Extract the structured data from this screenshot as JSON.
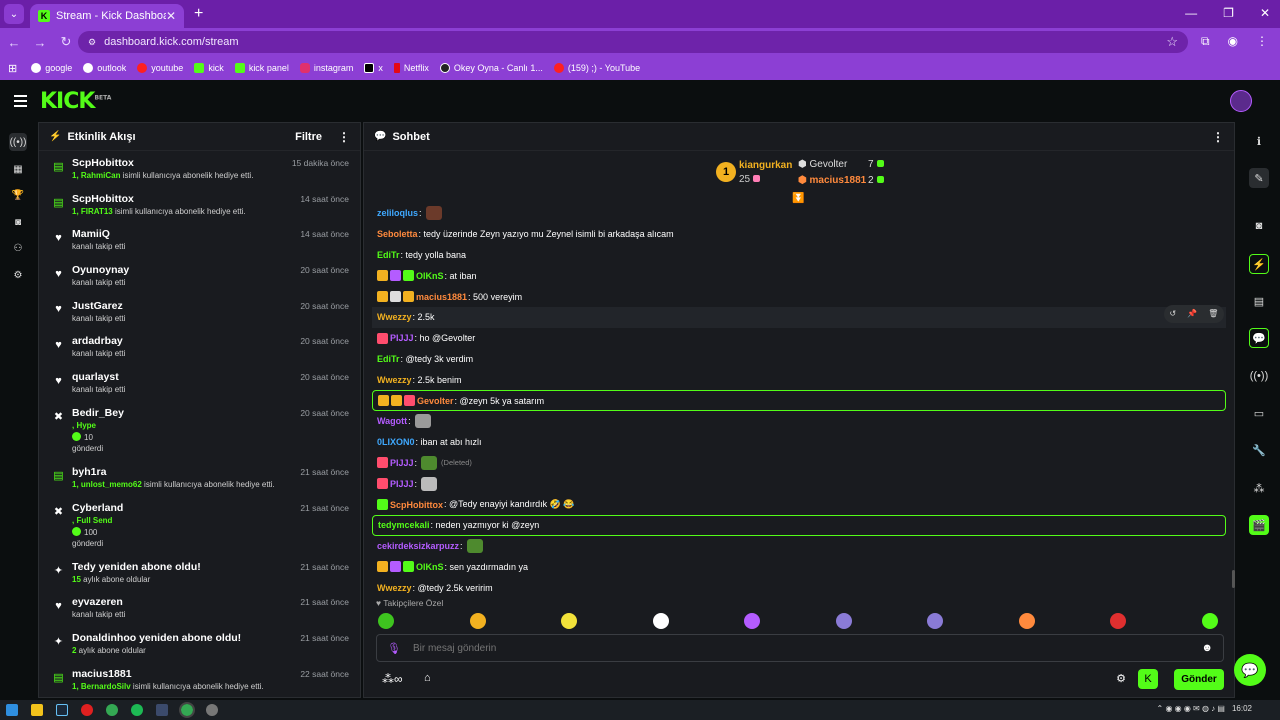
{
  "browser": {
    "tab_title": "Stream - Kick Dashboard",
    "url": "dashboard.kick.com/stream",
    "bookmarks": [
      {
        "label": "google",
        "color": "#ffffff"
      },
      {
        "label": "outlook",
        "color": "#ffffff"
      },
      {
        "label": "youtube",
        "color": "#ff2020"
      },
      {
        "label": "kick",
        "color": "#53fc18"
      },
      {
        "label": "kick panel",
        "color": "#53fc18"
      },
      {
        "label": "instagram",
        "color": "#e1306c"
      },
      {
        "label": "x",
        "color": "#ffffff"
      },
      {
        "label": "Netflix",
        "color": "#e50914"
      },
      {
        "label": "Okey Oyna - Canlı 1...",
        "color": "#222222"
      },
      {
        "label": "(159) ;) - YouTube",
        "color": "#ff2020"
      }
    ]
  },
  "brand": {
    "logo": "KICK",
    "beta": "BETA",
    "accent": "#53fc18"
  },
  "activity": {
    "title": "Etkinlik Akışı",
    "filter": "Filtre",
    "items": [
      {
        "icon": "gift",
        "name": "ScpHobittox",
        "time": "15 dakika önce",
        "hl": "1, RahmiCan",
        "text": " isimli kullanıcıya abonelik hediye etti."
      },
      {
        "icon": "gift",
        "name": "ScpHobittox",
        "time": "14 saat önce",
        "hl": "1, FIRAT13",
        "text": " isimli kullanıcıya abonelik hediye etti."
      },
      {
        "icon": "heart",
        "name": "MamiiQ",
        "time": "14 saat önce",
        "hl": "",
        "text": "kanalı takip etti"
      },
      {
        "icon": "heart",
        "name": "Oyunoynay",
        "time": "20 saat önce",
        "hl": "",
        "text": "kanalı takip etti"
      },
      {
        "icon": "heart",
        "name": "JustGarez",
        "time": "20 saat önce",
        "hl": "",
        "text": "kanalı takip etti"
      },
      {
        "icon": "heart",
        "name": "ardadrbay",
        "time": "20 saat önce",
        "hl": "",
        "text": "kanalı takip etti"
      },
      {
        "icon": "heart",
        "name": "quarlayst",
        "time": "20 saat önce",
        "hl": "",
        "text": "kanalı takip etti"
      },
      {
        "icon": "kicks",
        "name": "Bedir_Bey",
        "time": "20 saat önce",
        "hl": ", Hype",
        "amount": "10",
        "text": "gönderdi"
      },
      {
        "icon": "gift",
        "name": "byh1ra",
        "time": "21 saat önce",
        "hl": "1, unlost_memo62",
        "text": " isimli kullanıcıya abonelik hediye etti."
      },
      {
        "icon": "kicks",
        "name": "Cyberland",
        "time": "21 saat önce",
        "hl": ", Full Send",
        "amount": "100",
        "text": "gönderdi"
      },
      {
        "icon": "sparkle",
        "name": "Tedy yeniden abone oldu!",
        "time": "21 saat önce",
        "hl": "15",
        "text": " aylık abone oldular"
      },
      {
        "icon": "heart",
        "name": "eyvazeren",
        "time": "21 saat önce",
        "hl": "",
        "text": "kanalı takip etti"
      },
      {
        "icon": "sparkle",
        "name": "Donaldinhoo yeniden abone oldu!",
        "time": "21 saat önce",
        "hl": "2",
        "text": " aylık abone oldular"
      },
      {
        "icon": "gift",
        "name": "macius1881",
        "time": "22 saat önce",
        "hl": "1, BernardoSilv",
        "text": " isimli kullanıcıya abonelik hediye etti."
      }
    ]
  },
  "chat": {
    "title": "Sohbet",
    "leaderboard": {
      "rank": "1",
      "first_name": "kiangurkan",
      "first_count": "25",
      "second_name": "Gevolter",
      "second_count": "7",
      "third_name": "macius1881",
      "third_count": "2"
    },
    "messages": [
      {
        "user": "zeliloqlus",
        "color": "#3fa9ff",
        "badges": [],
        "text": ":",
        "emote": "#6b3a2a"
      },
      {
        "user": "Seboletta",
        "color": "#ff8a3d",
        "badges": [],
        "text": ": tedy üzerinde Zeyn yazıyo mu Zeynel isimli bi arkadaşa alıcam"
      },
      {
        "user": "EdiTr",
        "color": "#53fc18",
        "badges": [],
        "text": ": tedy yolla bana"
      },
      {
        "user": "OlKnS",
        "color": "#53fc18",
        "badges": [
          "#f2b120",
          "#b45cff",
          "#53fc18"
        ],
        "text": ": at iban"
      },
      {
        "user": "macius1881",
        "color": "#ff8a3d",
        "badges": [
          "#f2b120",
          "#dddddd",
          "#f2b120"
        ],
        "text": ": 500 vereyim"
      },
      {
        "user": "Wwezzy",
        "color": "#f2b120",
        "badges": [],
        "text": ": 2.5k",
        "hover": true
      },
      {
        "user": "PIJJJ",
        "color": "#b45cff",
        "badges": [
          "#ff4d6d"
        ],
        "text": ": ho @Gevolter"
      },
      {
        "user": "EdiTr",
        "color": "#53fc18",
        "badges": [],
        "text": ": @tedy 3k verdim"
      },
      {
        "user": "Wwezzy",
        "color": "#f2b120",
        "badges": [],
        "text": ": 2.5k benim"
      },
      {
        "user": "Gevolter",
        "color": "#ff8a3d",
        "badges": [
          "#f2b120",
          "#f2b120",
          "#ff4d6d"
        ],
        "text": ": @zeyn 5k ya satarım",
        "boxed": true
      },
      {
        "user": "Wagott",
        "color": "#b45cff",
        "badges": [],
        "text": ":",
        "emote": "#9a9a9a"
      },
      {
        "user": "0LIXON0",
        "color": "#3fa9ff",
        "badges": [],
        "text": ": iban at abı hızlı"
      },
      {
        "user": "PIJJJ",
        "color": "#b45cff",
        "badges": [
          "#ff4d6d"
        ],
        "text": ":",
        "emote": "#4e8a2e",
        "deleted": "(Deleted)"
      },
      {
        "user": "PIJJJ",
        "color": "#b45cff",
        "badges": [
          "#ff4d6d"
        ],
        "text": ":",
        "emote": "#bbbbbb"
      },
      {
        "user": "ScpHobittox",
        "color": "#ff8a3d",
        "badges": [
          "#53fc18"
        ],
        "text": ": @Tedy enayiyi kandırdık 🤣 😂"
      },
      {
        "user": "tedymcekali",
        "color": "#53fc18",
        "badges": [],
        "text": ": neden yazmıyor ki @zeyn",
        "boxed": true
      },
      {
        "user": "cekirdeksizkarpuzz",
        "color": "#b45cff",
        "badges": [],
        "text": ":",
        "emote": "#4e8a2e"
      },
      {
        "user": "OlKnS",
        "color": "#53fc18",
        "badges": [
          "#f2b120",
          "#b45cff",
          "#53fc18"
        ],
        "text": ": sen yazdırmadın ya"
      },
      {
        "user": "Wwezzy",
        "color": "#f2b120",
        "badges": [],
        "text": ": @tedy 2.5k veririm"
      }
    ],
    "followers_only": "Takipçilere Özel",
    "emotes": [
      "#3ec41f",
      "#f2b120",
      "#f2e23a",
      "#ffffff",
      "#b45cff",
      "#8a7bd6",
      "#8a7bd6",
      "#ff8a3d",
      "#e02f2f",
      "#53fc18"
    ],
    "input_placeholder": "Bir mesaj gönderin",
    "send_label": "Gönder"
  },
  "taskbar": {
    "time": "16:02"
  }
}
